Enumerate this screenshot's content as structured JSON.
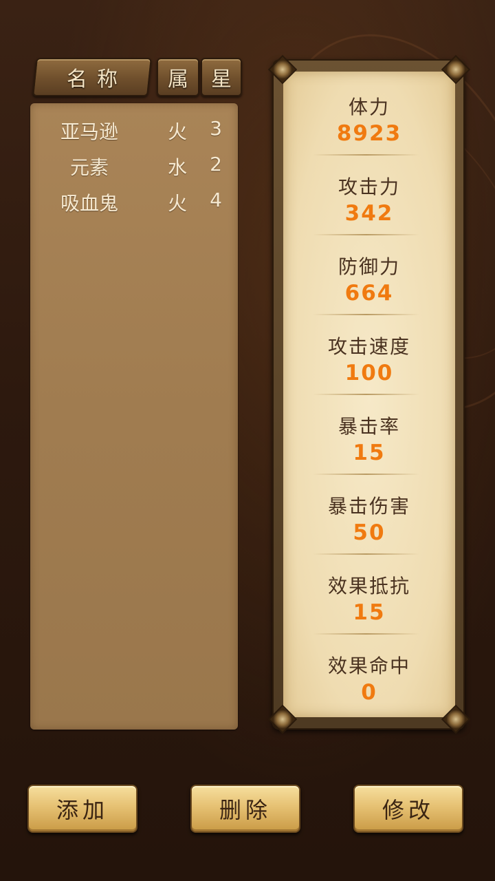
{
  "header": {
    "name_tab": "名称",
    "attr_tab": "属",
    "star_tab": "星"
  },
  "monsters": [
    {
      "name": "亚马逊",
      "attr": "火",
      "star": "3"
    },
    {
      "name": "元素",
      "attr": "水",
      "star": "2"
    },
    {
      "name": "吸血鬼",
      "attr": "火",
      "star": "4"
    }
  ],
  "stats": [
    {
      "label": "体力",
      "value": "8923"
    },
    {
      "label": "攻击力",
      "value": "342"
    },
    {
      "label": "防御力",
      "value": "664"
    },
    {
      "label": "攻击速度",
      "value": "100"
    },
    {
      "label": "暴击率",
      "value": "15"
    },
    {
      "label": "暴击伤害",
      "value": "50"
    },
    {
      "label": "效果抵抗",
      "value": "15"
    },
    {
      "label": "效果命中",
      "value": "0"
    }
  ],
  "buttons": {
    "add": "添加",
    "delete": "删除",
    "edit": "修改"
  },
  "colors": {
    "background": "#2d190e",
    "panel": "#a07c50",
    "paper": "#efdcb1",
    "stat_value": "#f07a10",
    "stat_label": "#4a3220",
    "button": "#e6c173"
  }
}
